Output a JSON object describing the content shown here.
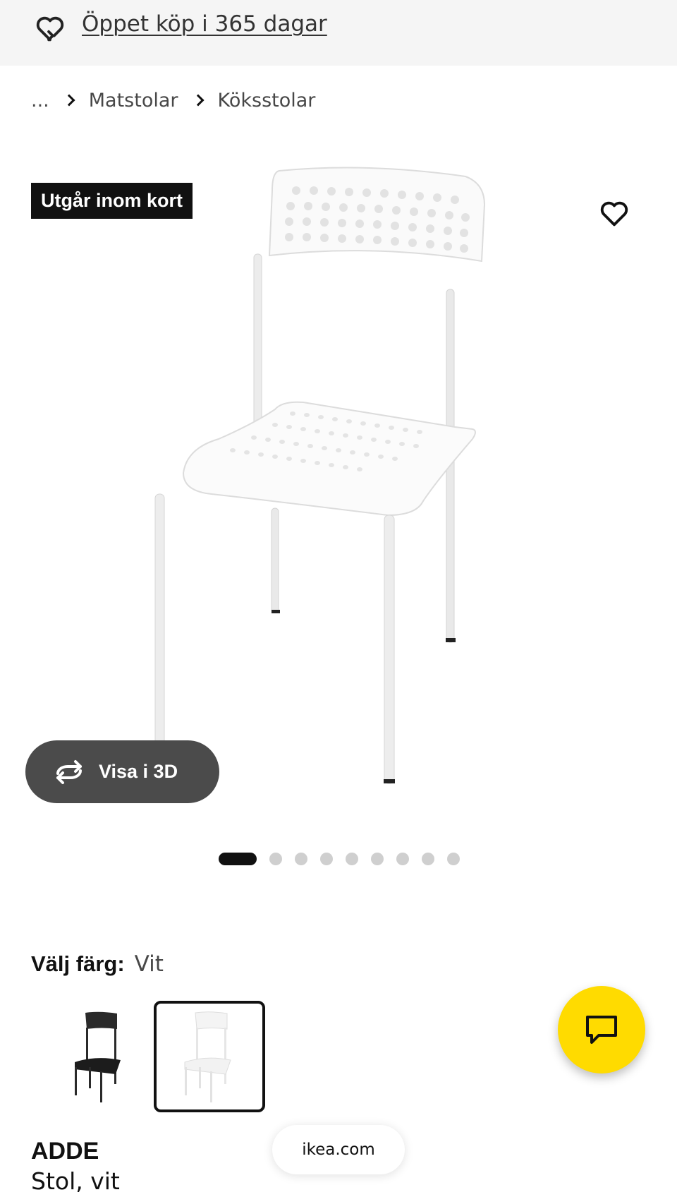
{
  "promo": {
    "text": "Öppet köp i 365 dagar",
    "icon": "return-heart-icon"
  },
  "breadcrumb": {
    "ellipsis": "...",
    "items": [
      "Matstolar",
      "Köksstolar"
    ]
  },
  "gallery": {
    "badge": "Utgår inom kort",
    "favorite_icon": "heart-icon",
    "view3d_label": "Visa i 3D",
    "view3d_icon": "rotate-arrows-icon",
    "image_count": 9,
    "active_index": 0
  },
  "color": {
    "label": "Välj färg:",
    "value": "Vit"
  },
  "swatches": [
    {
      "name": "black",
      "selected": false
    },
    {
      "name": "white",
      "selected": true
    }
  ],
  "chat": {
    "icon": "chat-bubble-icon",
    "color": "#ffdb00"
  },
  "product": {
    "name": "ADDE",
    "description": "Stol, vit"
  },
  "browser": {
    "domain": "ikea.com"
  }
}
